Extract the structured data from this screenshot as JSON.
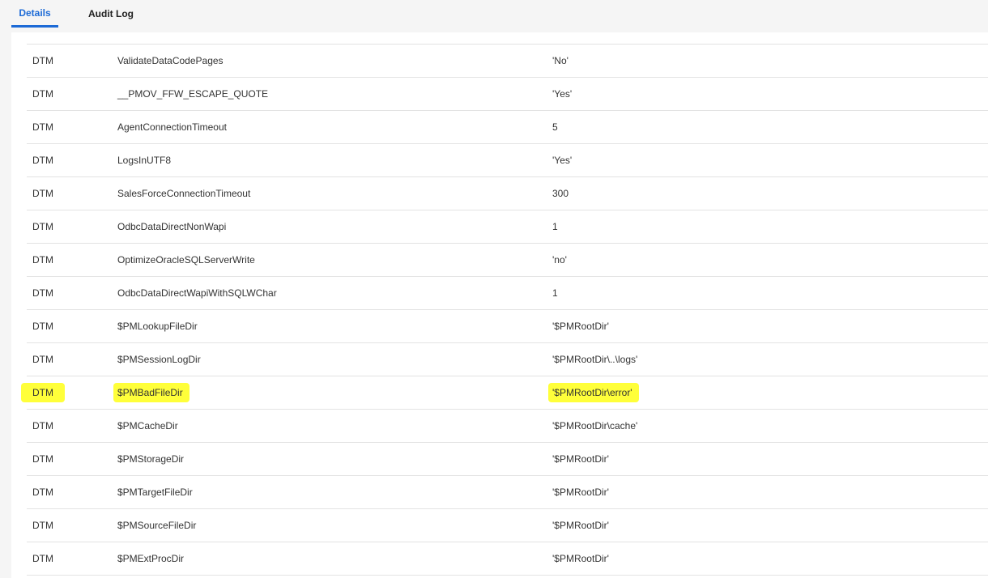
{
  "tabs": [
    {
      "label": "Details",
      "active": true
    },
    {
      "label": "Audit Log",
      "active": false
    }
  ],
  "highlight_color": "#ffff3a",
  "accent_color": "#1c6ad6",
  "rows": [
    {
      "type": "",
      "name": "",
      "value": ""
    },
    {
      "type": "DTM",
      "name": "ValidateDataCodePages",
      "value": "'No'"
    },
    {
      "type": "DTM",
      "name": "__PMOV_FFW_ESCAPE_QUOTE",
      "value": "'Yes'"
    },
    {
      "type": "DTM",
      "name": "AgentConnectionTimeout",
      "value": "5"
    },
    {
      "type": "DTM",
      "name": "LogsInUTF8",
      "value": "'Yes'"
    },
    {
      "type": "DTM",
      "name": "SalesForceConnectionTimeout",
      "value": "300"
    },
    {
      "type": "DTM",
      "name": "OdbcDataDirectNonWapi",
      "value": "1"
    },
    {
      "type": "DTM",
      "name": "OptimizeOracleSQLServerWrite",
      "value": "'no'"
    },
    {
      "type": "DTM",
      "name": "OdbcDataDirectWapiWithSQLWChar",
      "value": "1"
    },
    {
      "type": "DTM",
      "name": "$PMLookupFileDir",
      "value": "'$PMRootDir'"
    },
    {
      "type": "DTM",
      "name": "$PMSessionLogDir",
      "value": "'$PMRootDir\\..\\logs'"
    },
    {
      "type": "DTM",
      "name": "$PMBadFileDir",
      "value": "'$PMRootDir\\error'",
      "highlighted": true
    },
    {
      "type": "DTM",
      "name": "$PMCacheDir",
      "value": "'$PMRootDir\\cache'"
    },
    {
      "type": "DTM",
      "name": "$PMStorageDir",
      "value": "'$PMRootDir'"
    },
    {
      "type": "DTM",
      "name": "$PMTargetFileDir",
      "value": "'$PMRootDir'"
    },
    {
      "type": "DTM",
      "name": "$PMSourceFileDir",
      "value": "'$PMRootDir'"
    },
    {
      "type": "DTM",
      "name": "$PMExtProcDir",
      "value": "'$PMRootDir'"
    }
  ]
}
